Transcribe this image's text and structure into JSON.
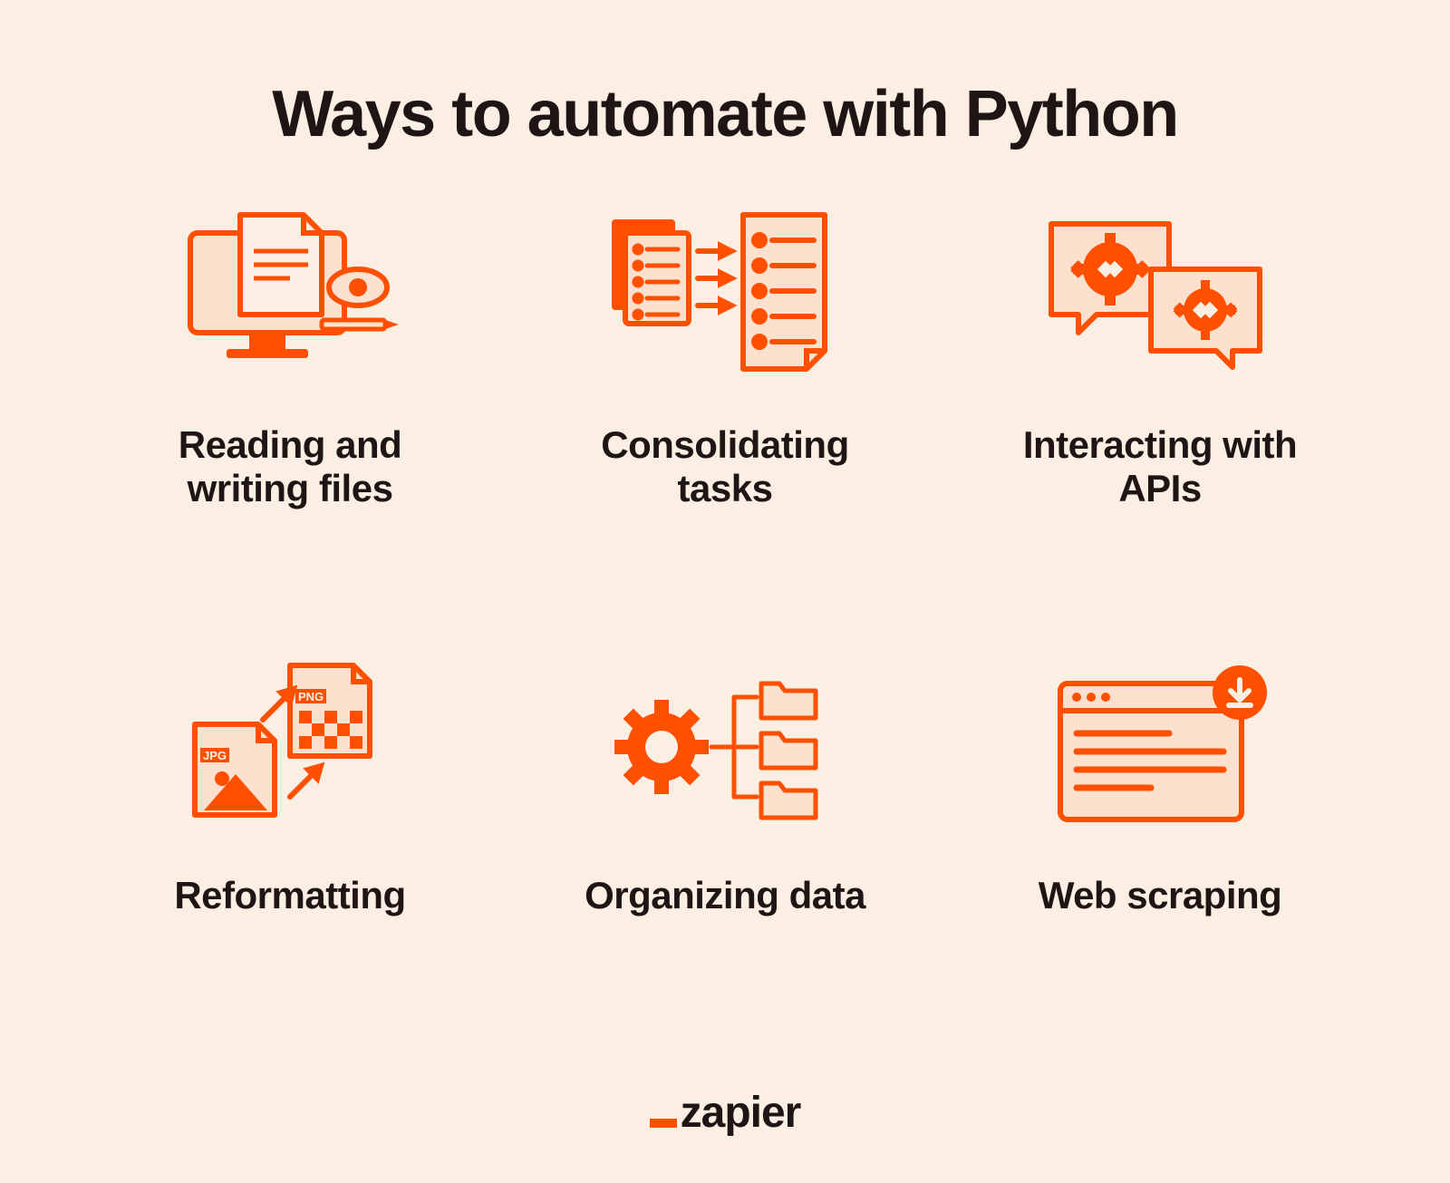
{
  "title": "Ways to automate with Python",
  "cells": [
    {
      "label": "Reading and writing files"
    },
    {
      "label": "Consolidating tasks"
    },
    {
      "label": "Interacting with APIs"
    },
    {
      "label": "Reformatting"
    },
    {
      "label": "Organizing data"
    },
    {
      "label": "Web scraping"
    }
  ],
  "logo": "zapier",
  "icon_labels": {
    "jpg": "JPG",
    "png": "PNG"
  },
  "colors": {
    "bg": "#FBEFE4",
    "dark": "#201515",
    "orange": "#FF4F00",
    "orange_light": "#FDE1CE"
  }
}
